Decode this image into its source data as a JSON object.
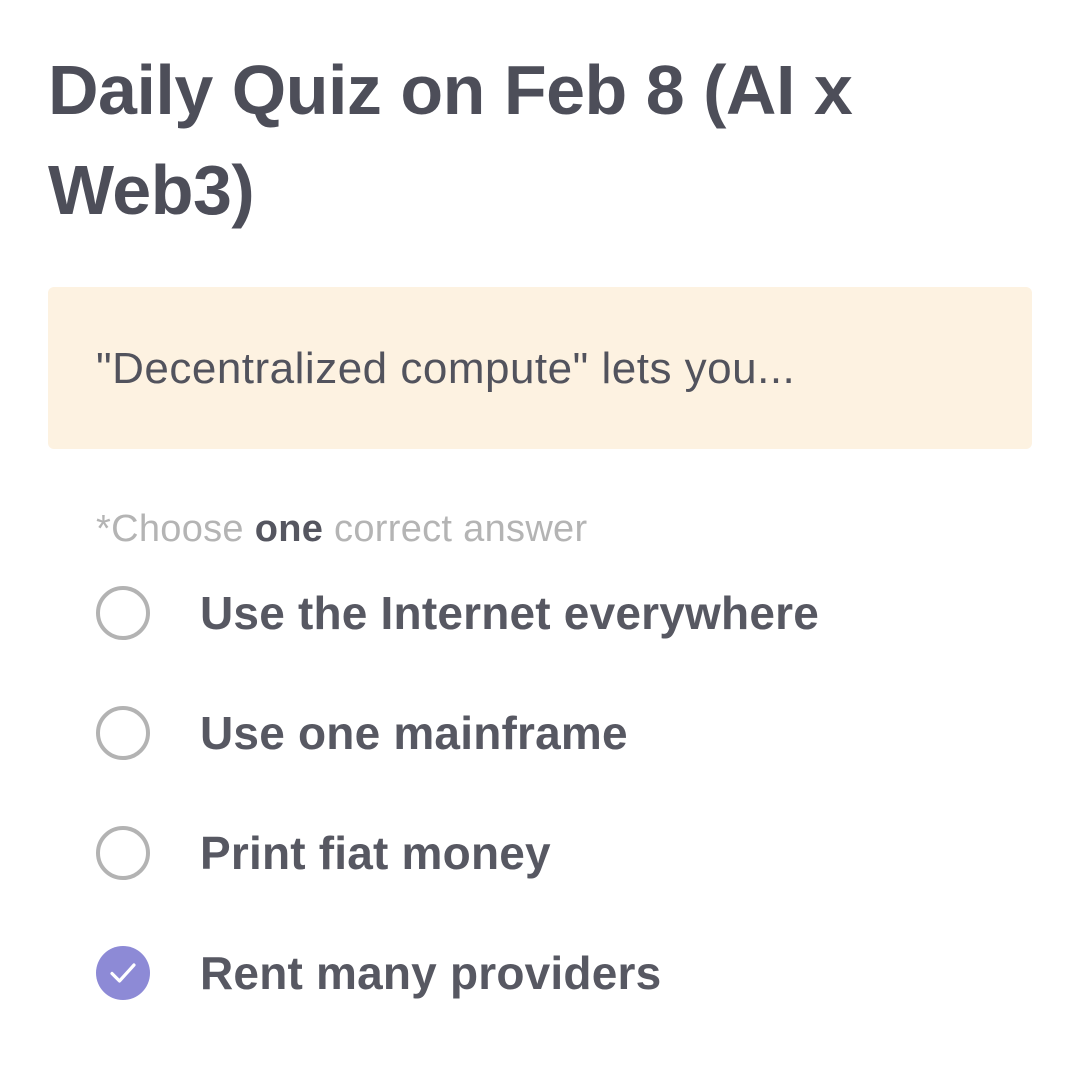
{
  "quiz": {
    "title": "Daily Quiz on Feb 8 (AI x Web3)",
    "question": "\"Decentralized compute\" lets you...",
    "instruction": {
      "prefix": "*Choose ",
      "emphasis": "one",
      "suffix": " correct answer"
    },
    "options": [
      {
        "label": "Use the Internet everywhere",
        "selected": false
      },
      {
        "label": "Use one mainframe",
        "selected": false
      },
      {
        "label": "Print fiat money",
        "selected": false
      },
      {
        "label": "Rent many providers",
        "selected": true
      }
    ],
    "selected_icon": "check-icon"
  },
  "colors": {
    "title_text": "#4d4e59",
    "question_background": "#fdf2e1",
    "instruction_text": "#b4b4b4",
    "radio_border": "#b3b3b3",
    "radio_selected": "#8d8ad6"
  }
}
